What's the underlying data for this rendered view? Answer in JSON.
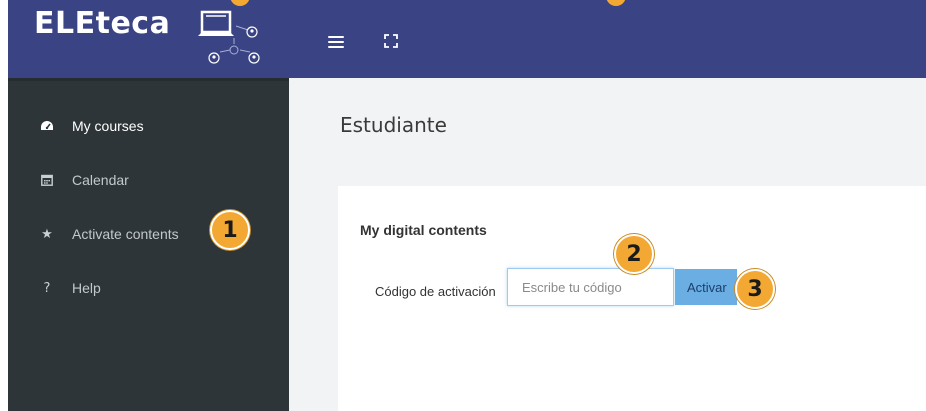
{
  "brand": {
    "name": "ELEteca"
  },
  "navbar": {
    "menu_icon": "hamburger-icon",
    "fullscreen_icon": "fullscreen-icon"
  },
  "sidebar": {
    "items": [
      {
        "label": "My courses",
        "icon": "dashboard-icon",
        "active": true
      },
      {
        "label": "Calendar",
        "icon": "calendar-icon",
        "active": false
      },
      {
        "label": "Activate contents",
        "icon": "star-icon",
        "active": false
      },
      {
        "label": "Help",
        "icon": "question-icon",
        "active": false
      }
    ]
  },
  "main": {
    "page_title": "Estudiante",
    "card": {
      "title": "My digital contents",
      "code_label": "Código de activación",
      "code_placeholder": "Escribe tu código",
      "code_value": "",
      "activate_label": "Activar"
    }
  },
  "callouts": [
    "1",
    "2",
    "3"
  ],
  "colors": {
    "navbar": "#3a4383",
    "sidebar": "#2d3539",
    "main_bg": "#f2f3f5",
    "button": "#6aaee3",
    "callout": "#f3a833"
  }
}
